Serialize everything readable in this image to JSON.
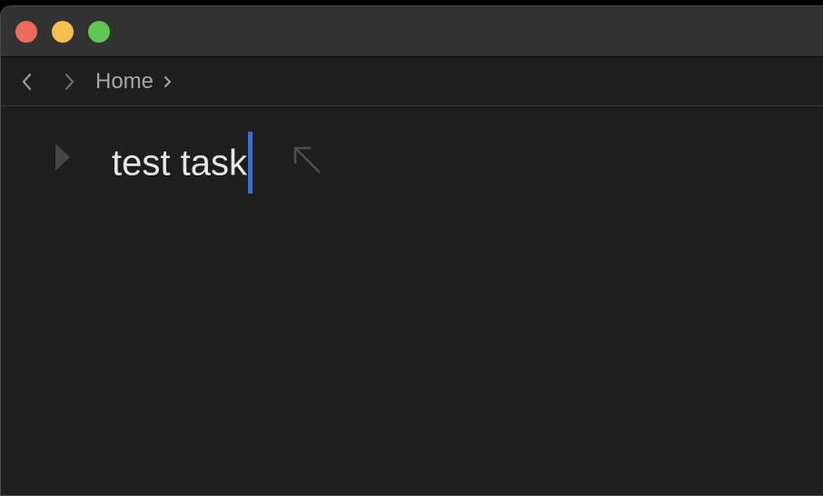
{
  "window": {
    "traffic_lights": {
      "close_color": "#ed6a5e",
      "minimize_color": "#f5bf4f",
      "zoom_color": "#61c554"
    }
  },
  "toolbar": {
    "back_icon": "chevron-left-icon",
    "forward_icon": "chevron-right-icon",
    "breadcrumb": {
      "home_label": "Home",
      "separator_icon": "chevron-right-icon"
    }
  },
  "main": {
    "task": {
      "text": "test task",
      "expand_icon": "disclosure-triangle-icon",
      "open_icon": "arrow-up-left-icon",
      "cursor_color": "#2f6df6"
    }
  }
}
